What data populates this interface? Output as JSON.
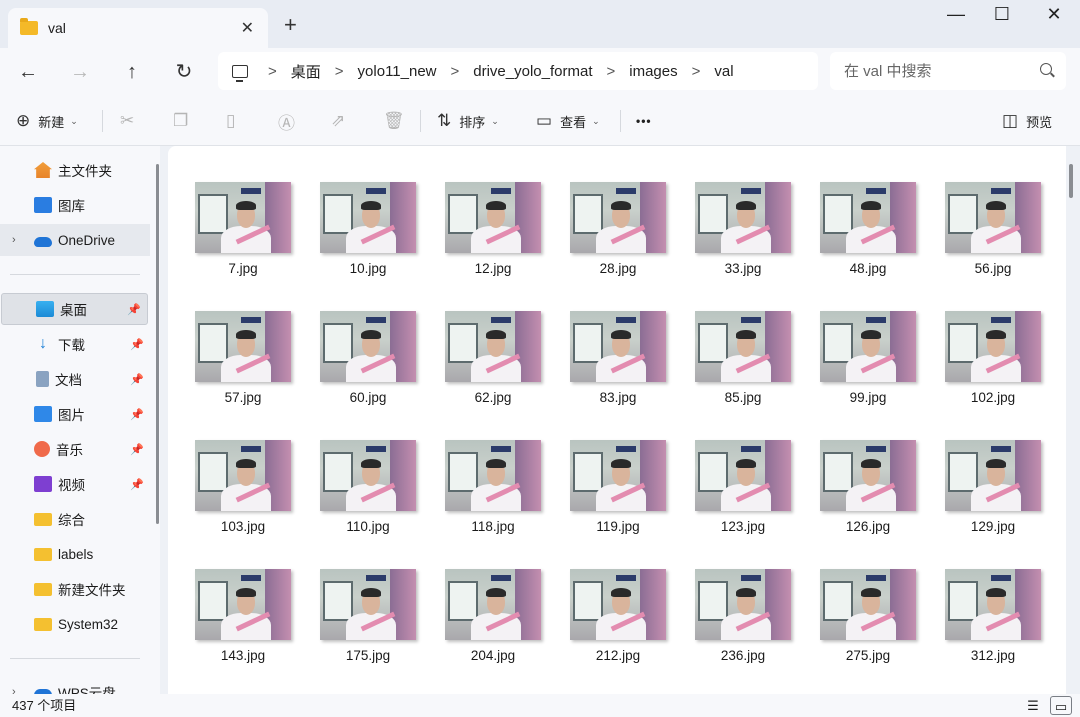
{
  "window": {
    "tab_title": "val",
    "new_tab": "+",
    "tab_close": "✕",
    "minimize": "—",
    "maximize": "☐",
    "close": "✕"
  },
  "nav": {
    "back": "←",
    "forward": "→",
    "up": "↑",
    "refresh": "↻"
  },
  "address": {
    "separator": ">",
    "crumbs": [
      "桌面",
      "yolo11_new",
      "drive_yolo_format",
      "images",
      "val"
    ]
  },
  "search": {
    "placeholder": "在 val 中搜索"
  },
  "toolbar": {
    "new_label": "新建",
    "sort_label": "排序",
    "view_label": "查看",
    "more": "•••",
    "preview_label": "预览"
  },
  "sidebar": {
    "items": [
      {
        "label": "主文件夹",
        "icon": "home-icon"
      },
      {
        "label": "图库",
        "icon": "gallery-icon"
      },
      {
        "label": "OneDrive",
        "icon": "cloud-icon"
      },
      {
        "label": "桌面",
        "icon": "desktop-icon",
        "pinned": true,
        "selected": true
      },
      {
        "label": "下载",
        "icon": "download-icon",
        "pinned": true
      },
      {
        "label": "文档",
        "icon": "document-icon",
        "pinned": true
      },
      {
        "label": "图片",
        "icon": "pictures-icon",
        "pinned": true
      },
      {
        "label": "音乐",
        "icon": "music-icon",
        "pinned": true
      },
      {
        "label": "视频",
        "icon": "video-icon",
        "pinned": true
      },
      {
        "label": "综合",
        "icon": "folder-icon"
      },
      {
        "label": "labels",
        "icon": "folder-icon"
      },
      {
        "label": "新建文件夹",
        "icon": "folder-icon"
      },
      {
        "label": "System32",
        "icon": "folder-icon"
      },
      {
        "label": "WPS云盘",
        "icon": "cloud-icon"
      }
    ]
  },
  "files": [
    "7.jpg",
    "10.jpg",
    "12.jpg",
    "28.jpg",
    "33.jpg",
    "48.jpg",
    "56.jpg",
    "57.jpg",
    "60.jpg",
    "62.jpg",
    "83.jpg",
    "85.jpg",
    "99.jpg",
    "102.jpg",
    "103.jpg",
    "110.jpg",
    "118.jpg",
    "119.jpg",
    "123.jpg",
    "126.jpg",
    "129.jpg",
    "143.jpg",
    "175.jpg",
    "204.jpg",
    "212.jpg",
    "236.jpg",
    "275.jpg",
    "312.jpg"
  ],
  "status": {
    "count_text": "437 个项目"
  }
}
